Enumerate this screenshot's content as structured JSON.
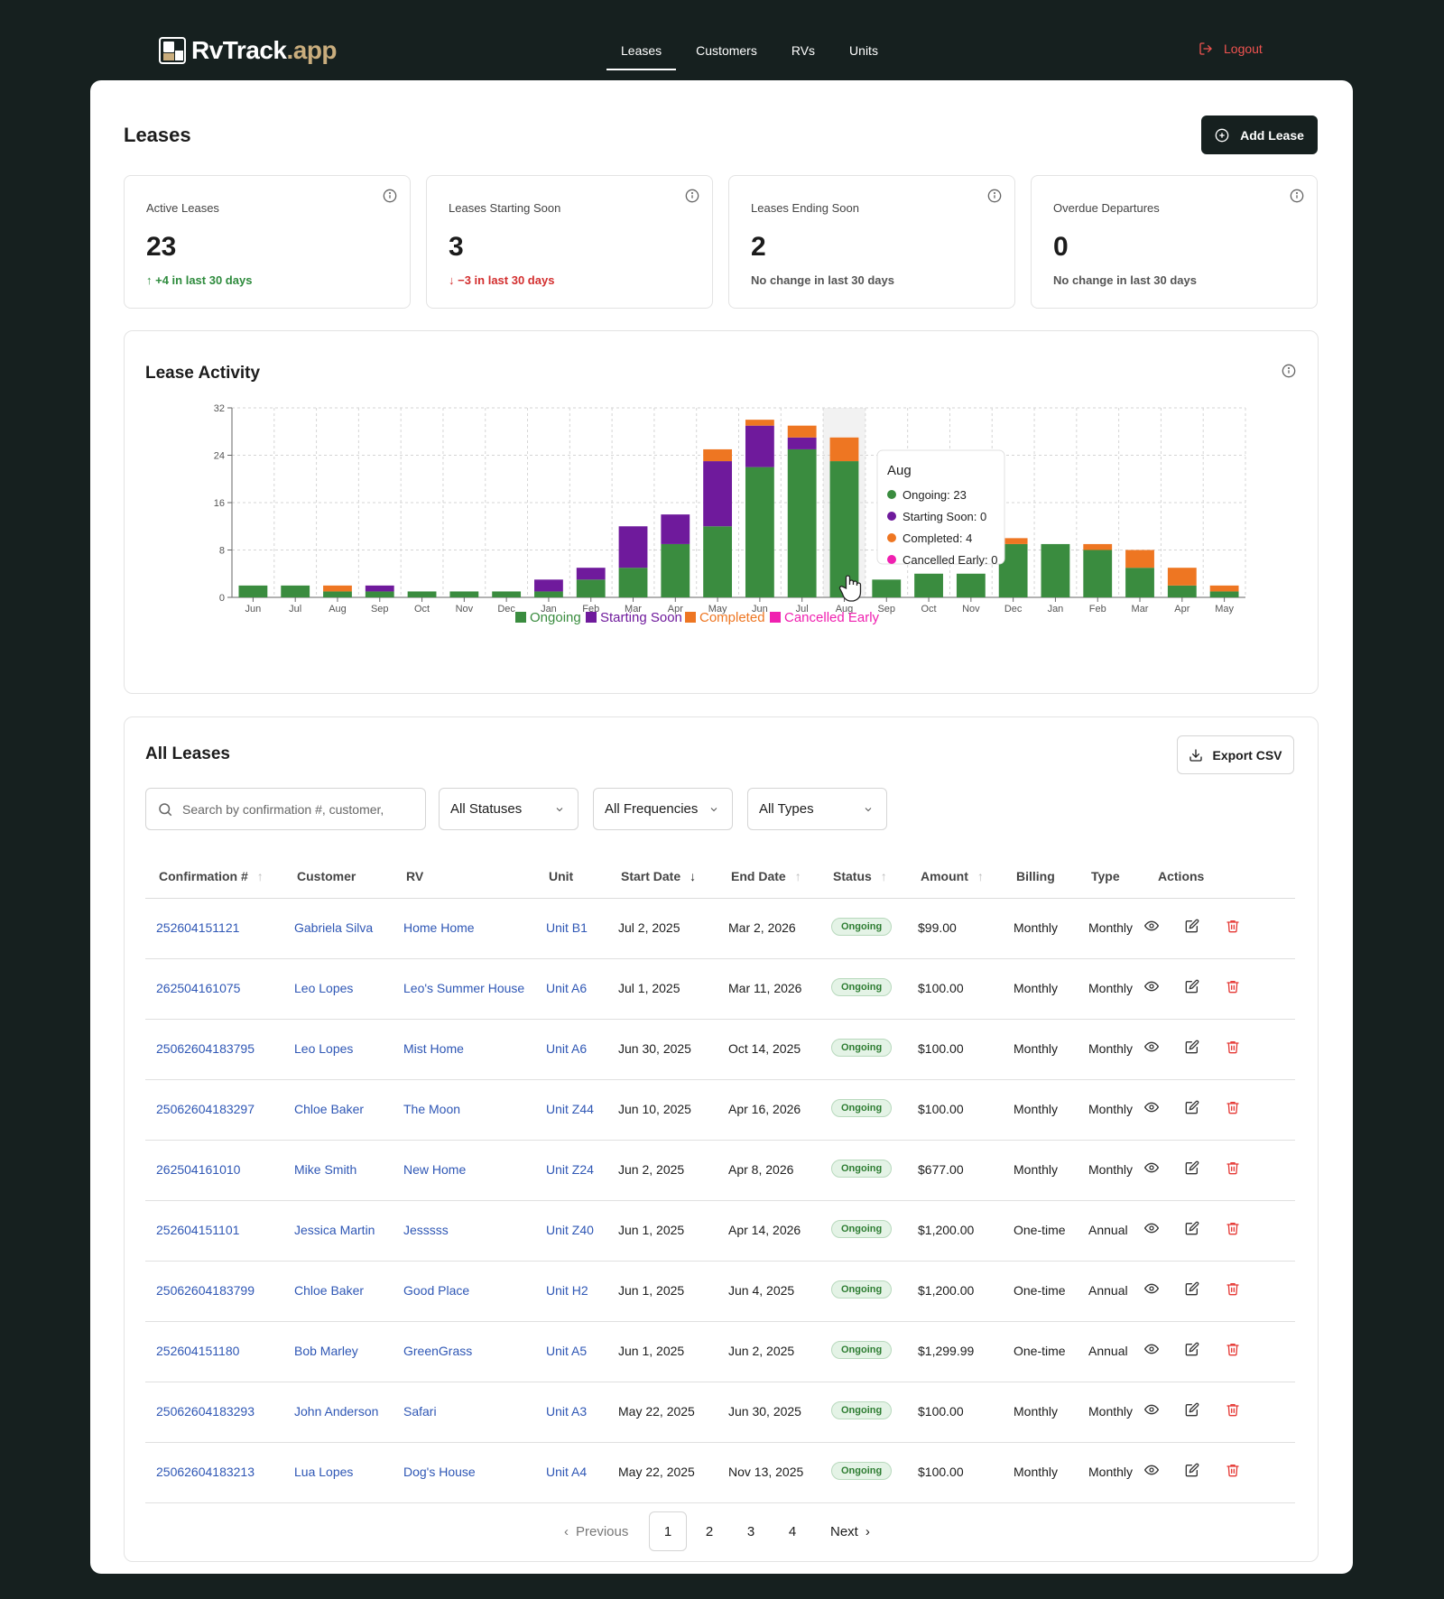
{
  "brand": {
    "name": "RvTrack",
    "suffix": ".app"
  },
  "nav": [
    {
      "label": "Leases",
      "active": true
    },
    {
      "label": "Customers",
      "active": false
    },
    {
      "label": "RVs",
      "active": false
    },
    {
      "label": "Units",
      "active": false
    }
  ],
  "logout_label": "Logout",
  "page_title": "Leases",
  "add_lease_label": "Add Lease",
  "stats": [
    {
      "label": "Active Leases",
      "value": "23",
      "change": "↑ +4 in last 30 days",
      "trend": "up"
    },
    {
      "label": "Leases Starting Soon",
      "value": "3",
      "change": "↓ −3 in last 30 days",
      "trend": "down"
    },
    {
      "label": "Leases Ending Soon",
      "value": "2",
      "change": "No change in last 30 days",
      "trend": "none"
    },
    {
      "label": "Overdue Departures",
      "value": "0",
      "change": "No change in last 30 days",
      "trend": "none"
    }
  ],
  "chart_panel_title": "Lease Activity",
  "chart_data": {
    "type": "bar",
    "stacked": true,
    "title": "Lease Activity",
    "categories": [
      "Jun",
      "Jul",
      "Aug",
      "Sep",
      "Oct",
      "Nov",
      "Dec",
      "Jan",
      "Feb",
      "Mar",
      "Apr",
      "May",
      "Jun",
      "Jul",
      "Aug",
      "Sep",
      "Oct",
      "Nov",
      "Dec",
      "Jan",
      "Feb",
      "Mar",
      "Apr",
      "May"
    ],
    "series": [
      {
        "name": "Ongoing",
        "color": "#3a8c3f",
        "values": [
          2,
          2,
          1,
          1,
          1,
          1,
          1,
          1,
          3,
          5,
          9,
          12,
          22,
          25,
          23,
          3,
          4,
          4,
          9,
          9,
          8,
          5,
          2,
          1
        ]
      },
      {
        "name": "Starting Soon",
        "color": "#6f1a9c",
        "values": [
          0,
          0,
          0,
          1,
          0,
          0,
          0,
          2,
          2,
          7,
          5,
          11,
          7,
          2,
          0,
          0,
          0,
          0,
          0,
          0,
          0,
          0,
          0,
          0
        ]
      },
      {
        "name": "Completed",
        "color": "#ee7622",
        "values": [
          0,
          0,
          1,
          0,
          0,
          0,
          0,
          0,
          0,
          0,
          0,
          2,
          1,
          2,
          4,
          0,
          0,
          0,
          1,
          0,
          1,
          3,
          3,
          1
        ]
      },
      {
        "name": "Cancelled Early",
        "color": "#f020b0",
        "values": [
          0,
          0,
          0,
          0,
          0,
          0,
          0,
          0,
          0,
          0,
          0,
          0,
          0,
          0,
          0,
          0,
          0,
          0,
          0,
          0,
          0,
          0,
          0,
          0
        ]
      }
    ],
    "ylim": [
      0,
      32
    ],
    "yticks": [
      "0",
      "8",
      "16",
      "24",
      "32"
    ],
    "grid": true,
    "legend": "bottom",
    "highlight_index": 14,
    "tooltip": {
      "title": "Aug",
      "items": [
        "Ongoing: 23",
        "Starting Soon: 0",
        "Completed: 4",
        "Cancelled Early: 0"
      ]
    }
  },
  "leases_title": "All Leases",
  "export_label": "Export CSV",
  "search_placeholder": "Search by confirmation #, customer,",
  "filters": [
    "All Statuses",
    "All Frequencies",
    "All Types"
  ],
  "columns": [
    "Confirmation #",
    "Customer",
    "RV",
    "Unit",
    "Start Date",
    "End Date",
    "Status",
    "Amount",
    "Billing",
    "Type",
    "Actions"
  ],
  "rows": [
    {
      "conf": "252604151121",
      "customer": "Gabriela Silva",
      "rv": "Home Home",
      "unit": "Unit B1",
      "start": "Jul 2, 2025",
      "end": "Mar 2, 2026",
      "status": "Ongoing",
      "amount": "$99.00",
      "billing": "Monthly",
      "type": "Monthly"
    },
    {
      "conf": "262504161075",
      "customer": "Leo Lopes",
      "rv": "Leo's Summer House",
      "unit": "Unit A6",
      "start": "Jul 1, 2025",
      "end": "Mar 11, 2026",
      "status": "Ongoing",
      "amount": "$100.00",
      "billing": "Monthly",
      "type": "Monthly"
    },
    {
      "conf": "25062604183795",
      "customer": "Leo Lopes",
      "rv": "Mist Home",
      "unit": "Unit A6",
      "start": "Jun 30, 2025",
      "end": "Oct 14, 2025",
      "status": "Ongoing",
      "amount": "$100.00",
      "billing": "Monthly",
      "type": "Monthly"
    },
    {
      "conf": "25062604183297",
      "customer": "Chloe Baker",
      "rv": "The Moon",
      "unit": "Unit Z44",
      "start": "Jun 10, 2025",
      "end": "Apr 16, 2026",
      "status": "Ongoing",
      "amount": "$100.00",
      "billing": "Monthly",
      "type": "Monthly"
    },
    {
      "conf": "262504161010",
      "customer": "Mike Smith",
      "rv": "New Home",
      "unit": "Unit Z24",
      "start": "Jun 2, 2025",
      "end": "Apr 8, 2026",
      "status": "Ongoing",
      "amount": "$677.00",
      "billing": "Monthly",
      "type": "Monthly"
    },
    {
      "conf": "252604151101",
      "customer": "Jessica Martin",
      "rv": "Jesssss",
      "unit": "Unit Z40",
      "start": "Jun 1, 2025",
      "end": "Apr 14, 2026",
      "status": "Ongoing",
      "amount": "$1,200.00",
      "billing": "One-time",
      "type": "Annual"
    },
    {
      "conf": "25062604183799",
      "customer": "Chloe Baker",
      "rv": "Good Place",
      "unit": "Unit H2",
      "start": "Jun 1, 2025",
      "end": "Jun 4, 2025",
      "status": "Ongoing",
      "amount": "$1,200.00",
      "billing": "One-time",
      "type": "Annual"
    },
    {
      "conf": "252604151180",
      "customer": "Bob Marley",
      "rv": "GreenGrass",
      "unit": "Unit A5",
      "start": "Jun 1, 2025",
      "end": "Jun 2, 2025",
      "status": "Ongoing",
      "amount": "$1,299.99",
      "billing": "One-time",
      "type": "Annual"
    },
    {
      "conf": "25062604183293",
      "customer": "John Anderson",
      "rv": "Safari",
      "unit": "Unit A3",
      "start": "May 22, 2025",
      "end": "Jun 30, 2025",
      "status": "Ongoing",
      "amount": "$100.00",
      "billing": "Monthly",
      "type": "Monthly"
    },
    {
      "conf": "25062604183213",
      "customer": "Lua Lopes",
      "rv": "Dog's House",
      "unit": "Unit A4",
      "start": "May 22, 2025",
      "end": "Nov 13, 2025",
      "status": "Ongoing",
      "amount": "$100.00",
      "billing": "Monthly",
      "type": "Monthly"
    }
  ],
  "pagination": {
    "previous": "Previous",
    "next": "Next",
    "pages": [
      "1",
      "2",
      "3",
      "4"
    ],
    "current": "1"
  },
  "icons": {
    "logout": "logout-icon",
    "add": "plus-circle-icon",
    "info": "info-icon",
    "export": "download-icon",
    "search": "search-icon",
    "chevron": "chevron-down-icon",
    "view": "eye-icon",
    "edit": "edit-icon",
    "delete": "trash-icon"
  }
}
